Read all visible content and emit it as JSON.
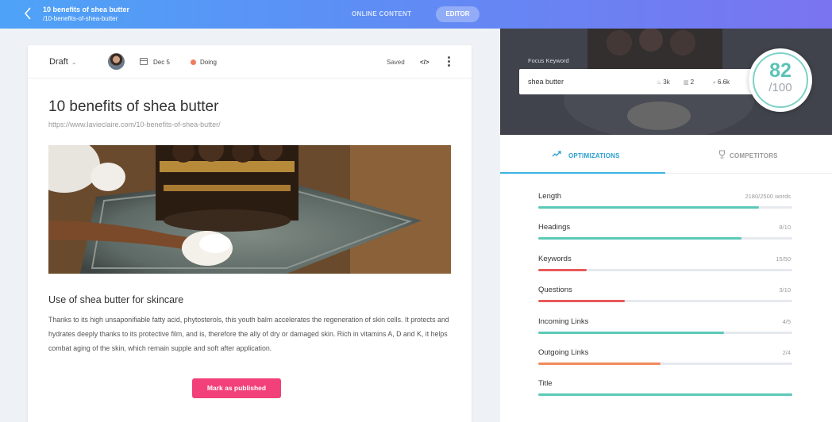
{
  "topbar": {
    "title": "10 benefits of shea butter",
    "slug": "/10-benefits-of-shea-butter",
    "tab_online": "ONLINE CONTENT",
    "tab_editor": "EDITOR"
  },
  "editor": {
    "status": "Draft",
    "date": "Dec 5",
    "state": "Doing",
    "saved": "Saved",
    "code_icon": "</>",
    "title": "10 benefits of shea butter",
    "url": "https://www.lavieclaire.com/10-benefits-of-shea-butter/",
    "section_heading": "Use of shea butter for skincare",
    "paragraph": "Thanks to its high unsaponifiable fatty acid, phytosterols, this youth balm accelerates the regeneration of skin cells. It protects and hydrates deeply thanks to its protective film, and is, therefore the ally of dry or damaged skin. Rich in vitamins A, D and K, it helps combat aging of the skin, which remain supple and soft after application.",
    "publish_label": "Mark as published"
  },
  "keyword": {
    "label": "Focus Keyword",
    "value": "shea butter",
    "stat_flame": "3k",
    "stat_bars": "2",
    "stat_search": "6.6k"
  },
  "score": {
    "value": "82",
    "max": "/100"
  },
  "tabs": {
    "optimizations": "OPTIMIZATIONS",
    "competitors": "COMPETITORS"
  },
  "metrics": [
    {
      "name": "Length",
      "value": "2180/2500 words",
      "fill": 0.87,
      "color": "#5cc9b8"
    },
    {
      "name": "Headings",
      "value": "8/10",
      "fill": 0.8,
      "color": "#5cc9b8"
    },
    {
      "name": "Keywords",
      "value": "15/50",
      "fill": 0.19,
      "color": "#e85a5a"
    },
    {
      "name": "Questions",
      "value": "3/10",
      "fill": 0.34,
      "color": "#e85a5a"
    },
    {
      "name": "Incoming Links",
      "value": "4/5",
      "fill": 0.73,
      "color": "#5cc9b8"
    },
    {
      "name": "Outgoing Links",
      "value": "2/4",
      "fill": 0.48,
      "color": "#f08a5e"
    },
    {
      "name": "Title",
      "value": "",
      "fill": 1.0,
      "color": "#5cc9b8"
    }
  ]
}
